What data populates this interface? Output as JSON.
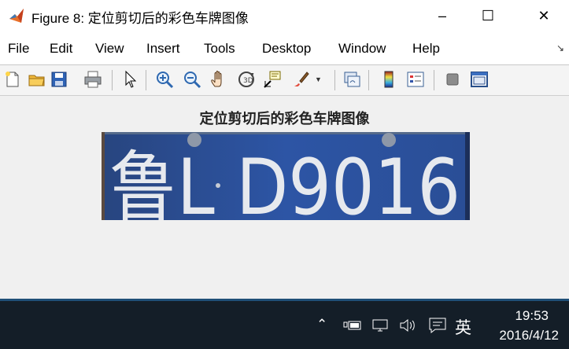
{
  "window": {
    "title": "Figure 8: 定位剪切后的彩色车牌图像",
    "minimize_glyph": "–",
    "maximize_glyph": "☐",
    "close_glyph": "✕"
  },
  "menu": {
    "items": [
      {
        "label": "File"
      },
      {
        "label": "Edit"
      },
      {
        "label": "View"
      },
      {
        "label": "Insert"
      },
      {
        "label": "Tools"
      },
      {
        "label": "Desktop"
      },
      {
        "label": "Window"
      },
      {
        "label": "Help"
      }
    ],
    "dock_arrow": "↘"
  },
  "toolbar": {
    "icons": [
      "new-figure-icon",
      "open-file-icon",
      "save-icon",
      "print-icon",
      "pointer-icon",
      "zoom-in-icon",
      "zoom-out-icon",
      "pan-icon",
      "rotate-3d-icon",
      "data-cursor-icon",
      "brush-icon",
      "link-plot-icon",
      "colorbar-icon",
      "legend-icon",
      "hide-plot-tools-icon",
      "show-plot-tools-icon"
    ]
  },
  "figure": {
    "title": "定位剪切后的彩色车牌图像",
    "plate_text": "鲁L D9016",
    "plate_colors": {
      "background": "#2a4f9c",
      "characters": "#e6e9ee"
    }
  },
  "taskbar": {
    "ime_label": "英",
    "time": "19:53",
    "date": "2016/4/12",
    "tray_icons": [
      "show-hidden-icons-icon",
      "power-icon",
      "network-icon",
      "volume-icon",
      "action-center-icon"
    ]
  }
}
